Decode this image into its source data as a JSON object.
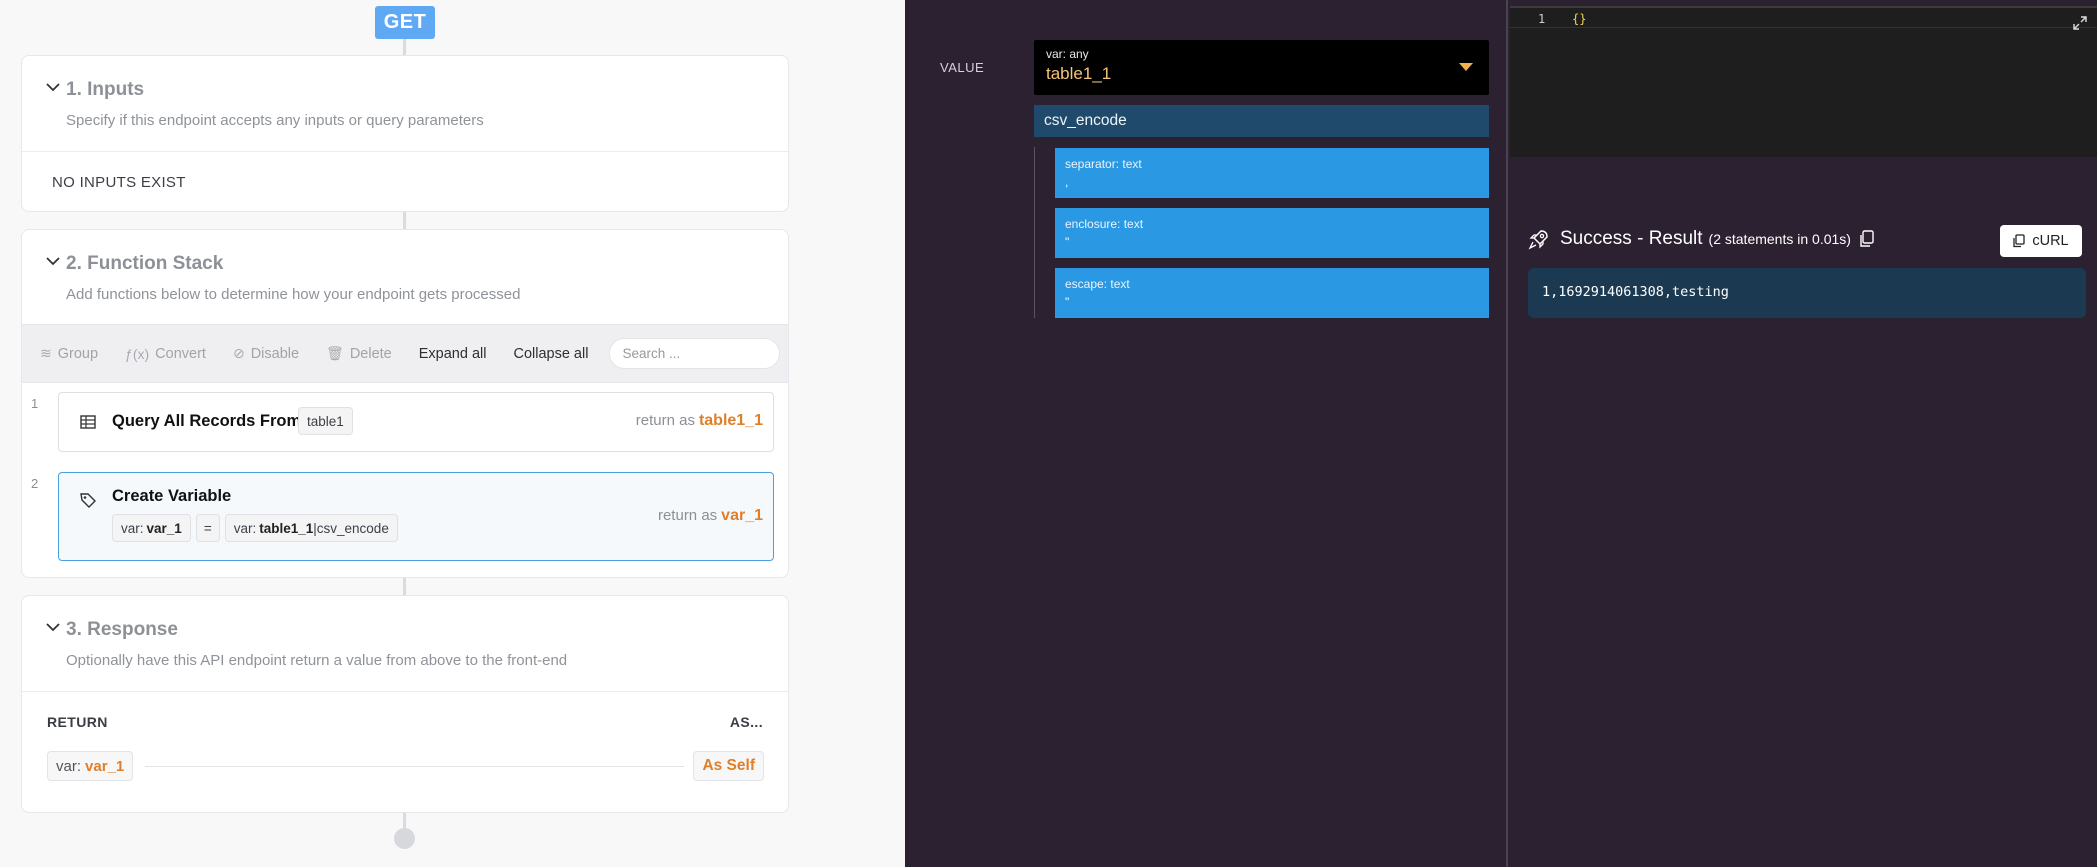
{
  "endpoint": {
    "method": "GET"
  },
  "inputs": {
    "title": "1. Inputs",
    "subtitle": "Specify if this endpoint accepts any inputs or query parameters",
    "empty_text": "NO INPUTS EXIST"
  },
  "function_stack": {
    "title": "2. Function Stack",
    "subtitle": "Add functions below to determine how your endpoint gets processed",
    "toolbar": {
      "group": "Group",
      "convert": "Convert",
      "disable": "Disable",
      "delete": "Delete",
      "expand_all": "Expand all",
      "collapse_all": "Collapse all",
      "search_placeholder": "Search ..."
    },
    "steps": [
      {
        "number": "1",
        "title": "Query All Records From",
        "table_chip": "table1",
        "return_label": "return as",
        "return_value": "table1_1"
      },
      {
        "number": "2",
        "title": "Create Variable",
        "chip_var_prefix": "var:",
        "chip_var_name": "var_1",
        "equals": "=",
        "chip_value_prefix": "var:",
        "chip_value_name": "table1_1",
        "chip_value_filter": "|csv_encode",
        "return_label": "return as",
        "return_value": "var_1"
      }
    ]
  },
  "response": {
    "title": "3. Response",
    "subtitle": "Optionally have this API endpoint return a value from above to the front-end",
    "return_label": "RETURN",
    "as_label": "AS...",
    "return_prefix": "var:",
    "return_value": "var_1",
    "as_value": "As Self"
  },
  "editor_panel": {
    "value_label": "VALUE",
    "var_type": "var: any",
    "var_value": "table1_1",
    "filter_name": "csv_encode",
    "args": [
      {
        "name": "separator: text",
        "value": ","
      },
      {
        "name": "enclosure: text",
        "value": "\""
      },
      {
        "name": "escape: text",
        "value": "\""
      }
    ]
  },
  "result_panel": {
    "code_line_number": "1",
    "code_text": "{}",
    "title": "Success - Result",
    "meta": "(2 statements in 0.01s)",
    "curl_label": "cURL",
    "output": "1,1692914061308,testing"
  },
  "colors": {
    "accent_orange": "#df7f2a",
    "get_badge": "#5fa9f4",
    "arg_blue": "#2a98e3",
    "filter_head": "#1f4a6b",
    "dark_panel": "#2b2130"
  }
}
